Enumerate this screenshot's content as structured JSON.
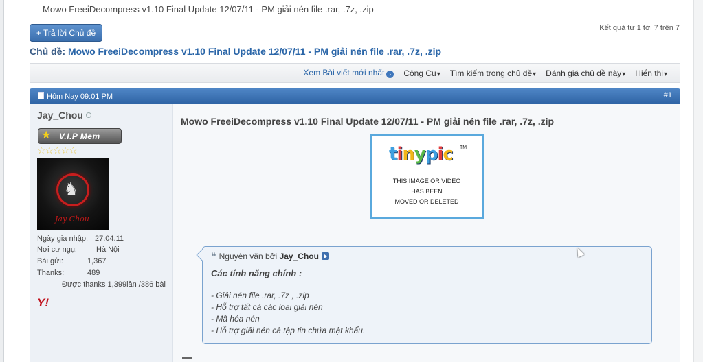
{
  "page": {
    "heading": "Mowo FreeiDecompress v1.10 Final Update 12/07/11 - PM giải nén file .rar, .7z, .zip",
    "reply_button": "+ Trả lời Chủ đề",
    "results": "Kết quả từ 1 tới 7 trên 7",
    "thread_label": "Chủ đề:",
    "thread_title": "Mowo FreeiDecompress v1.10 Final Update 12/07/11 - PM giải nén file .rar, .7z, .zip"
  },
  "toolbar": {
    "new_posts": "Xem Bài viết mới nhất",
    "tools": "Công Cụ",
    "search_thread": "Tìm kiếm trong chủ đề",
    "rate_thread": "Đánh giá chủ đề này",
    "display": "Hiển thị"
  },
  "post": {
    "date": "Hôm Nay 09:01 PM",
    "number": "#1",
    "title": "Mowo FreeiDecompress v1.10 Final Update 12/07/11 - PM giải nén file .rar, .7z, .zip",
    "image": {
      "logo": "tinypic",
      "trademark": "TM",
      "lines": [
        "THIS IMAGE OR VIDEO",
        "HAS BEEN",
        "MOVED OR DELETED"
      ]
    },
    "quote": {
      "prefix": "Nguyên văn bởi",
      "author": "Jay_Chou",
      "title": "Các tính năng chính :",
      "lines": [
        "- Giải nén file .rar, .7z , .zip",
        "- Hỗ trợ tất cả các loại giải nén",
        "- Mã hóa nén",
        "- Hỗ trợ giải nén cả tập tin chứa mật khẩu."
      ]
    }
  },
  "user": {
    "name": "Jay_Chou",
    "rank": "V.I.P Mem",
    "stars": "☆☆☆☆☆",
    "avatar_signature": "Jay Chou",
    "join_label": "Ngày gia nhập:",
    "join_value": "27.04.11",
    "location_label": "Nơi cư ngụ:",
    "location_value": "Hà Nội",
    "posts_label": "Bài gửi:",
    "posts_value": "1,367",
    "thanks_label": "Thanks:",
    "thanks_value": "489",
    "thanked": "Được thanks 1,399lần /386 bài",
    "yahoo_icon": "Y!"
  },
  "colors": {
    "post_header": "#3a70b2",
    "link": "#2b66a8",
    "quote_border": "#7aa3cf"
  }
}
